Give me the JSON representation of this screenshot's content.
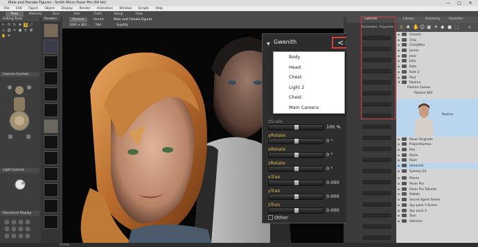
{
  "window": {
    "title": "Male and Female Figures - Smith Micro Poser Pro (64 bit)",
    "controls": [
      "—",
      "□",
      "✕"
    ]
  },
  "menubar": [
    "File",
    "Edit",
    "Figure",
    "Object",
    "Display",
    "Render",
    "Animation",
    "Window",
    "Scripts",
    "Help"
  ],
  "rooms": [
    {
      "label": "Pose",
      "active": true
    },
    {
      "label": "Material",
      "active": false
    },
    {
      "label": "Face",
      "active": false
    },
    {
      "label": "Hair",
      "active": false
    },
    {
      "label": "Cloth",
      "active": false
    },
    {
      "label": "Setup",
      "active": false
    },
    {
      "label": "Help",
      "active": false
    }
  ],
  "left_panel": {
    "editing_tools_title": "Editing Tools",
    "camera_controls_title": "Camera Controls",
    "light_controls_title": "Light Controls",
    "document_display_title": "Document Display"
  },
  "thumbcol_title": "Renders",
  "viewport": {
    "tabs": [
      "Preview",
      "Render"
    ],
    "doc_title": "Male and Female Figures",
    "resolution": "1005 x 801...",
    "figure_menu": "Pad",
    "view_menu": "Sup4ify"
  },
  "parameters": {
    "title": "Gwenith",
    "nav_back": "<",
    "nav_forward": ">",
    "dropdown_items": [
      "Body",
      "Head",
      "Chest",
      "Light 2",
      "Chest",
      "Main Camera"
    ],
    "rows": [
      {
        "label": "zScale",
        "value": "100 %"
      },
      {
        "label": "yRotate",
        "value": "0 °"
      },
      {
        "label": "xRotate",
        "value": "0 °"
      },
      {
        "label": "zRotate",
        "value": "0 °"
      },
      {
        "label": "xTran",
        "value": "0.000"
      },
      {
        "label": "yTran",
        "value": "0.000"
      },
      {
        "label": "zTran",
        "value": "0.000"
      }
    ],
    "other_label": "Other"
  },
  "mid_panel": {
    "title": "Gwenith",
    "tabs": [
      "Parameters",
      "Properties"
    ]
  },
  "right_panel": {
    "tabs": [
      "Library",
      "Hierarchy",
      "Favorites"
    ],
    "items": [
      "Cheech",
      "Chip",
      "CindyMen",
      "James",
      "Jessi",
      "Jolly",
      "Kate",
      "Kate 2",
      "Paul",
      "Pauline",
      "Pauline Casual",
      "Pauline SKV",
      "Pauline",
      "Poser Originals",
      "ProjectHuman",
      "Rex",
      "Roxie",
      "Ryan",
      "SimonG2",
      "Sydney G2",
      "Places",
      "Poser Pro",
      "Poser Pro Tutorial",
      "Robots",
      "Secret Agent Series",
      "Spy pack 3 Scene",
      "Spy pack 3",
      "Toys",
      "Vehicles"
    ]
  },
  "status_text": "UI Dots"
}
